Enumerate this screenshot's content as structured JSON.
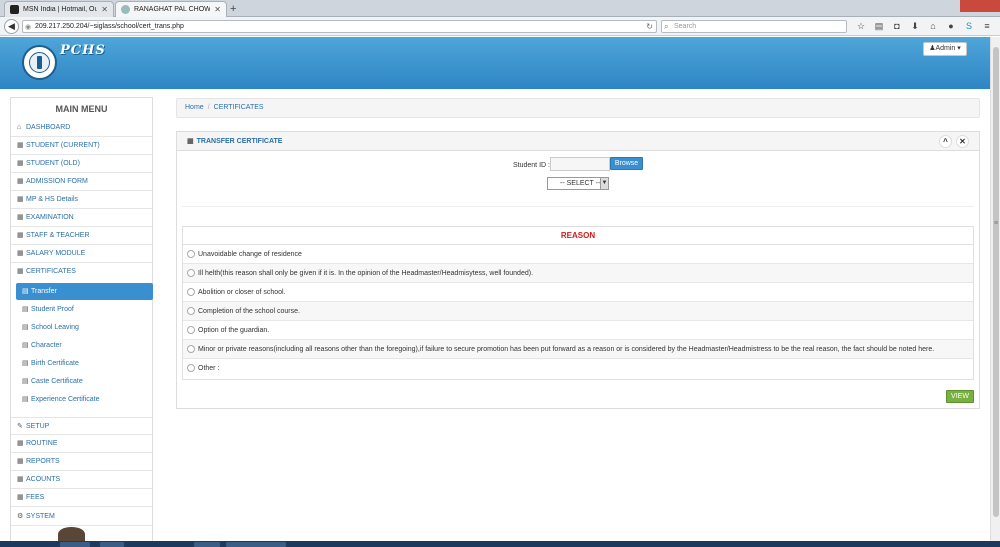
{
  "browser": {
    "tabs": [
      {
        "title": "MSN India | Hotmail, Outlo...",
        "active": false
      },
      {
        "title": "RANAGHAT PAL CHOWD...",
        "active": true
      }
    ],
    "url": "209.217.250.204/~siglass/school/cert_trans.php",
    "search_placeholder": "Search"
  },
  "header": {
    "brand": "PCHS",
    "user_label": "Admin"
  },
  "sidebar": {
    "title": "MAIN MENU",
    "items": [
      {
        "label": "DASHBOARD",
        "icon": "home-icon"
      },
      {
        "label": "STUDENT (CURRENT)",
        "icon": "grid-icon"
      },
      {
        "label": "STUDENT (OLD)",
        "icon": "grid-icon"
      },
      {
        "label": "ADMISSION FORM",
        "icon": "grid-icon"
      },
      {
        "label": "MP & HS Details",
        "icon": "grid-icon"
      },
      {
        "label": "EXAMINATION",
        "icon": "grid-icon"
      },
      {
        "label": "STAFF & TEACHER",
        "icon": "grid-icon"
      },
      {
        "label": "SALARY MODULE",
        "icon": "grid-icon"
      },
      {
        "label": "CERTIFICATES",
        "icon": "grid-icon"
      }
    ],
    "certificates_sub": [
      {
        "label": "Transfer",
        "active": true
      },
      {
        "label": "Student Proof"
      },
      {
        "label": "School Leaving"
      },
      {
        "label": "Character"
      },
      {
        "label": "Birth Certificate"
      },
      {
        "label": "Caste Certificate"
      },
      {
        "label": "Experience Certificate"
      }
    ],
    "items_after": [
      {
        "label": "SETUP",
        "icon": "wrench-icon"
      },
      {
        "label": "ROUTINE",
        "icon": "grid-icon"
      },
      {
        "label": "REPORTS",
        "icon": "grid-icon"
      },
      {
        "label": "ACOUNTS",
        "icon": "grid-icon"
      },
      {
        "label": "FEES",
        "icon": "grid-icon"
      },
      {
        "label": "SYSTEM",
        "icon": "gears-icon"
      }
    ]
  },
  "breadcrumb": {
    "home": "Home",
    "current": "CERTIFICATES"
  },
  "panel": {
    "title": "TRANSFER CERTIFICATE",
    "student_id_label": "Student ID :",
    "student_id_value": "",
    "browse_label": "Browse",
    "select_value": "-- SELECT --",
    "reason_heading": "REASON",
    "reasons": [
      "Unavoidable change of residence",
      "Ill helth(this reason shall only be given if it is. In the opinion of the Headmaster/Headmisytess, well founded).",
      "Abolition or closer of school.",
      "Completion of the school course.",
      "Option of the guardian.",
      "Minor or private reasons(including all reasons other than the foregoing),if failure to secure promotion has been put forward as a reason or is considered by the Headmaster/Headmistress to be the real reason, the fact should be noted here.",
      "Other :"
    ],
    "view_label": "VIEW"
  },
  "colors": {
    "header_blue": "#2e85c4",
    "link_blue": "#2a6fa8",
    "active_blue": "#3a8fd0",
    "reason_red": "#d21b1b",
    "view_green": "#78b13f"
  }
}
